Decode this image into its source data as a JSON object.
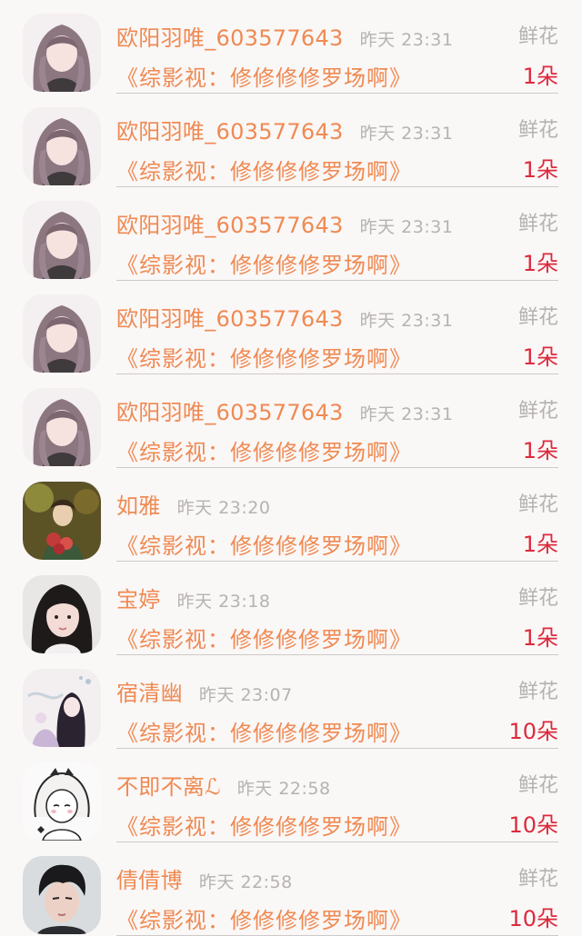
{
  "colors": {
    "background": "#faf7f7",
    "name_accent": "#ef8a52",
    "muted_text": "#b7b2b2",
    "count_red": "#dc2a3c",
    "divider": "#cfcaca"
  },
  "records": [
    {
      "name": "欧阳羽唯_603577643",
      "time": "昨天 23:31",
      "gift": "鲜花",
      "book": "《综影视：修修修修罗场啊》",
      "count": "1朵",
      "avatar": "anime-girl-avatar"
    },
    {
      "name": "欧阳羽唯_603577643",
      "time": "昨天 23:31",
      "gift": "鲜花",
      "book": "《综影视：修修修修罗场啊》",
      "count": "1朵",
      "avatar": "anime-girl-avatar"
    },
    {
      "name": "欧阳羽唯_603577643",
      "time": "昨天 23:31",
      "gift": "鲜花",
      "book": "《综影视：修修修修罗场啊》",
      "count": "1朵",
      "avatar": "anime-girl-avatar"
    },
    {
      "name": "欧阳羽唯_603577643",
      "time": "昨天 23:31",
      "gift": "鲜花",
      "book": "《综影视：修修修修罗场啊》",
      "count": "1朵",
      "avatar": "anime-girl-avatar"
    },
    {
      "name": "欧阳羽唯_603577643",
      "time": "昨天 23:31",
      "gift": "鲜花",
      "book": "《综影视：修修修修罗场啊》",
      "count": "1朵",
      "avatar": "anime-girl-avatar"
    },
    {
      "name": "如雅",
      "time": "昨天 23:20",
      "gift": "鲜花",
      "book": "《综影视：修修修修罗场啊》",
      "count": "1朵",
      "avatar": "painting-avatar"
    },
    {
      "name": "宝婷",
      "time": "昨天 23:18",
      "gift": "鲜花",
      "book": "《综影视：修修修修罗场啊》",
      "count": "1朵",
      "avatar": "girl-photo-avatar"
    },
    {
      "name": "宿清幽",
      "time": "昨天 23:07",
      "gift": "鲜花",
      "book": "《综影视：修修修修罗场啊》",
      "count": "10朵",
      "avatar": "illustration-avatar"
    },
    {
      "name": "不即不离ℒ",
      "time": "昨天 22:58",
      "gift": "鲜花",
      "book": "《综影视：修修修修罗场啊》",
      "count": "10朵",
      "avatar": "sketch-girl-avatar"
    },
    {
      "name": "倩倩博",
      "time": "昨天 22:58",
      "gift": "鲜花",
      "book": "《综影视：修修修修罗场啊》",
      "count": "10朵",
      "avatar": "boy-photo-avatar"
    }
  ]
}
